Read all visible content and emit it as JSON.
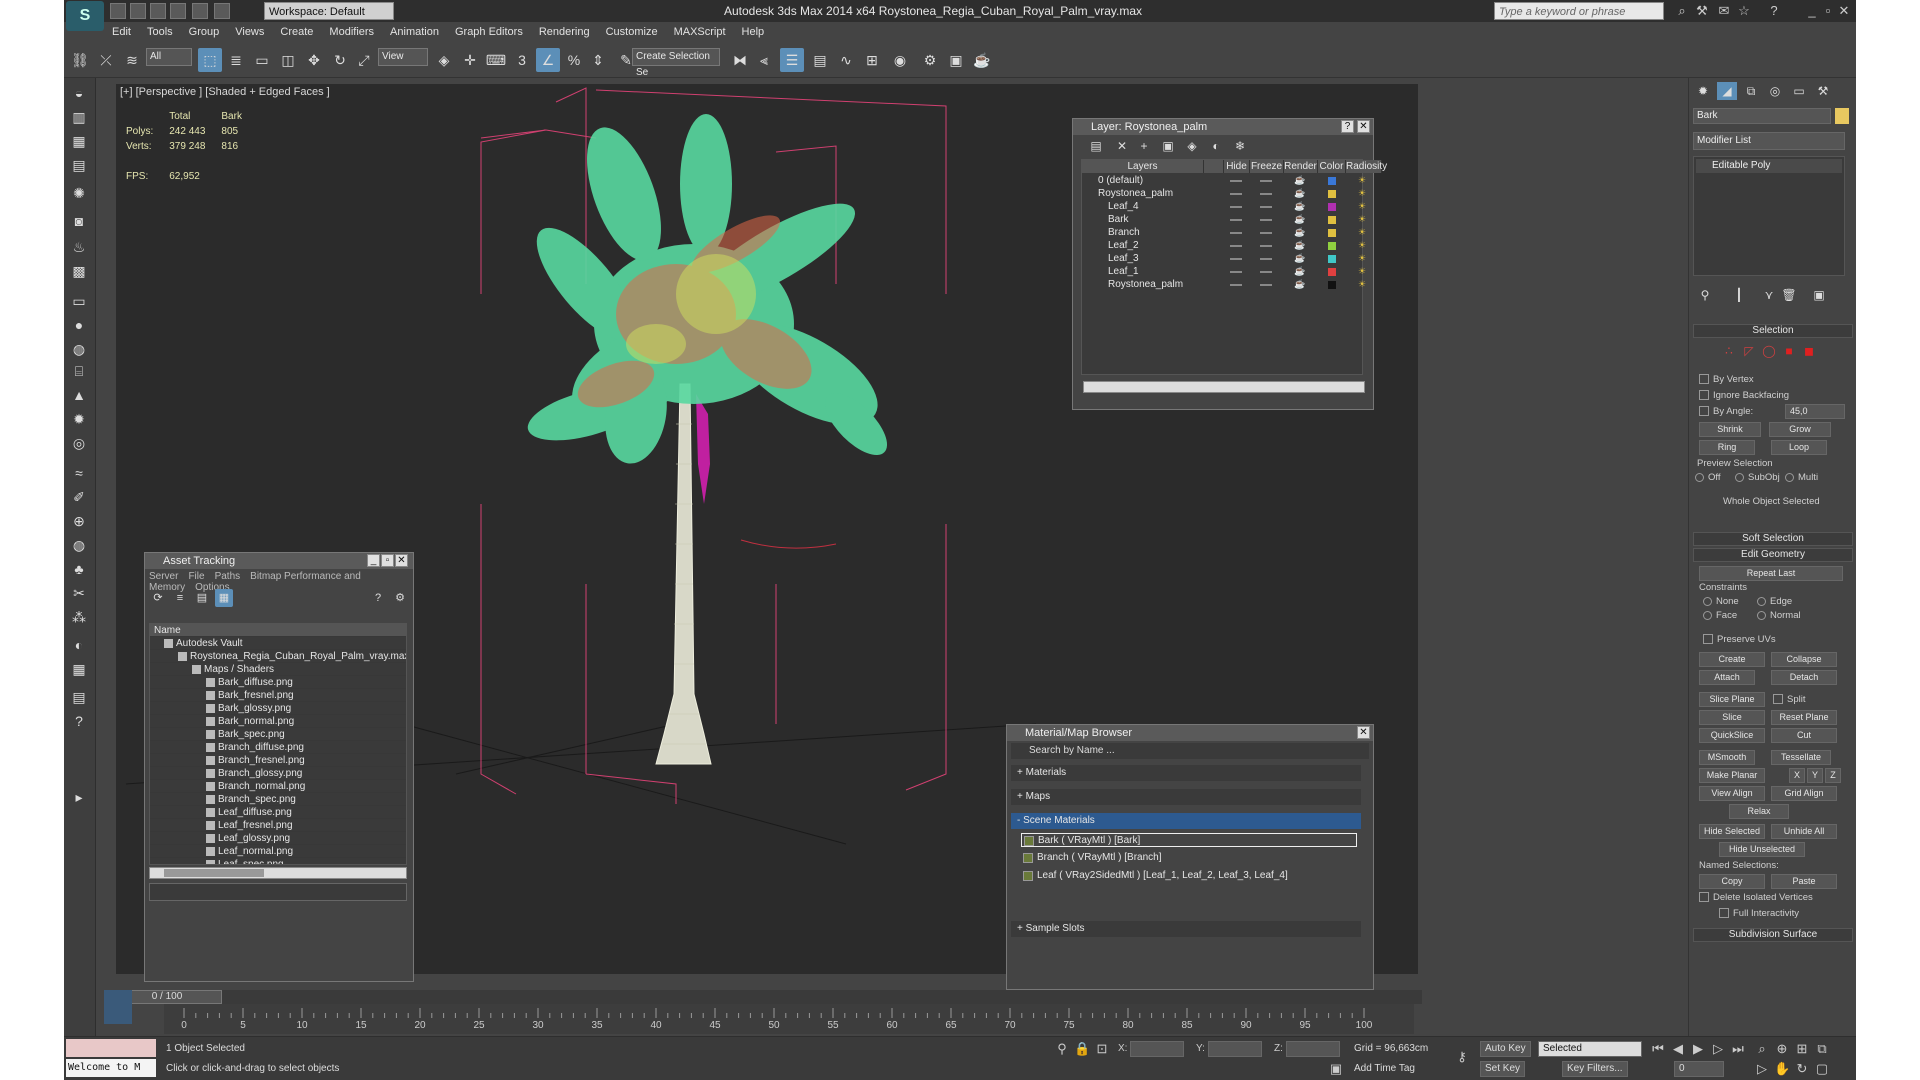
{
  "app": {
    "title": "Autodesk 3ds Max  2014 x64      Roystonea_Regia_Cuban_Royal_Palm_vray.max",
    "workspace": "Workspace: Default",
    "search_placeholder": "Type a keyword or phrase",
    "logo_icon": "3ds-max-logo-icon"
  },
  "menu": [
    "Edit",
    "Tools",
    "Group",
    "Views",
    "Create",
    "Modifiers",
    "Animation",
    "Graph Editors",
    "Rendering",
    "Customize",
    "MAXScript",
    "Help"
  ],
  "toolbar": {
    "filter_all": "All",
    "view_dropdown": "View",
    "snap_label": "3",
    "selection_set": "Create Selection Se"
  },
  "viewport": {
    "label": "[+] [Perspective ] [Shaded + Edged Faces ]",
    "stats": {
      "col_total": "Total",
      "col_selected": "Bark",
      "polys_label": "Polys:",
      "polys_total": "242 443",
      "polys_selected": "805",
      "verts_label": "Verts:",
      "verts_total": "379 248",
      "verts_selected": "816",
      "fps_label": "FPS:",
      "fps_value": "62,952"
    }
  },
  "asset_tracking": {
    "title": "Asset Tracking",
    "menu": [
      "Server",
      "File",
      "Paths",
      "Bitmap Performance and Memory",
      "Options"
    ],
    "column": "Name",
    "rows": [
      {
        "label": "Autodesk Vault",
        "indent": 1
      },
      {
        "label": "Roystonea_Regia_Cuban_Royal_Palm_vray.max",
        "indent": 2
      },
      {
        "label": "Maps / Shaders",
        "indent": 3
      },
      {
        "label": "Bark_diffuse.png",
        "indent": 4
      },
      {
        "label": "Bark_fresnel.png",
        "indent": 4
      },
      {
        "label": "Bark_glossy.png",
        "indent": 4
      },
      {
        "label": "Bark_normal.png",
        "indent": 4
      },
      {
        "label": "Bark_spec.png",
        "indent": 4
      },
      {
        "label": "Branch_diffuse.png",
        "indent": 4
      },
      {
        "label": "Branch_fresnel.png",
        "indent": 4
      },
      {
        "label": "Branch_glossy.png",
        "indent": 4
      },
      {
        "label": "Branch_normal.png",
        "indent": 4
      },
      {
        "label": "Branch_spec.png",
        "indent": 4
      },
      {
        "label": "Leaf_diffuse.png",
        "indent": 4
      },
      {
        "label": "Leaf_fresnel.png",
        "indent": 4
      },
      {
        "label": "Leaf_glossy.png",
        "indent": 4
      },
      {
        "label": "Leaf_normal.png",
        "indent": 4
      },
      {
        "label": "Leaf_spec.png",
        "indent": 4
      }
    ]
  },
  "layer_window": {
    "title": "Layer: Roystonea_palm",
    "columns": [
      "Layers",
      "Hide",
      "Freeze",
      "Render",
      "Color",
      "Radiosity"
    ],
    "rows": [
      {
        "name": "0 (default)",
        "indent": 1,
        "color": "#3a78d8"
      },
      {
        "name": "Roystonea_palm",
        "indent": 1,
        "color": "#e0c040"
      },
      {
        "name": "Leaf_4",
        "indent": 2,
        "color": "#b030b0"
      },
      {
        "name": "Bark",
        "indent": 2,
        "color": "#e0c040"
      },
      {
        "name": "Branch",
        "indent": 2,
        "color": "#e0c040"
      },
      {
        "name": "Leaf_2",
        "indent": 2,
        "color": "#90d040"
      },
      {
        "name": "Leaf_3",
        "indent": 2,
        "color": "#40c8c8"
      },
      {
        "name": "Leaf_1",
        "indent": 2,
        "color": "#e04040"
      },
      {
        "name": "Roystonea_palm",
        "indent": 2,
        "color": "#111111"
      }
    ]
  },
  "material_browser": {
    "title": "Material/Map Browser",
    "search": "Search by Name ...",
    "sections": [
      "+ Materials",
      "+ Maps",
      "- Scene Materials",
      "+ Sample Slots"
    ],
    "scene_materials": [
      "Bark  ( VRayMtl ) [Bark]",
      "Branch  ( VRayMtl ) [Branch]",
      "Leaf  ( VRay2SidedMtl ) [Leaf_1, Leaf_2, Leaf_3, Leaf_4]"
    ]
  },
  "command_panel": {
    "object_name": "Bark",
    "modifier_list": "Modifier List",
    "stack_item": "Editable Poly",
    "selection_title": "Selection",
    "by_vertex": "By Vertex",
    "ignore_backfacing": "Ignore Backfacing",
    "by_angle": "By Angle:",
    "angle_value": "45,0",
    "shrink": "Shrink",
    "grow": "Grow",
    "ring": "Ring",
    "loop": "Loop",
    "preview_selection": "Preview Selection",
    "preview_off": "Off",
    "preview_subobj": "SubObj",
    "preview_multi": "Multi",
    "whole_object": "Whole Object Selected",
    "soft_selection": "Soft Selection",
    "edit_geometry": "Edit Geometry",
    "repeat_last": "Repeat Last",
    "constraints": "Constraints",
    "c_none": "None",
    "c_edge": "Edge",
    "c_face": "Face",
    "c_normal": "Normal",
    "preserve_uvs": "Preserve UVs",
    "create": "Create",
    "collapse": "Collapse",
    "attach": "Attach",
    "detach": "Detach",
    "slice_plane": "Slice Plane",
    "split": "Split",
    "slice": "Slice",
    "reset_plane": "Reset Plane",
    "quickslice": "QuickSlice",
    "cut": "Cut",
    "msmooth": "MSmooth",
    "tessellate": "Tessellate",
    "make_planar": "Make Planar",
    "x": "X",
    "y": "Y",
    "z": "Z",
    "view_align": "View Align",
    "grid_align": "Grid Align",
    "relax": "Relax",
    "hide_selected": "Hide Selected",
    "unhide_all": "Unhide All",
    "hide_unselected": "Hide Unselected",
    "named_selections": "Named Selections:",
    "copy": "Copy",
    "paste": "Paste",
    "delete_isolated": "Delete Isolated Vertices",
    "full_interactivity": "Full Interactivity",
    "subdivision_surface": "Subdivision Surface"
  },
  "timeline": {
    "frame": "0 / 100",
    "ticks": [
      "0",
      "5",
      "10",
      "15",
      "20",
      "25",
      "30",
      "35",
      "40",
      "45",
      "50",
      "55",
      "60",
      "65",
      "70",
      "75",
      "80",
      "85",
      "90",
      "95",
      "100"
    ]
  },
  "status": {
    "maxscript": "Welcome to M",
    "selected": "1 Object Selected",
    "prompt": "Click or click-and-drag to select objects",
    "x_label": "X:",
    "y_label": "Y:",
    "z_label": "Z:",
    "grid": "Grid = 96,663cm",
    "add_time_tag": "Add Time Tag",
    "auto_key": "Auto Key",
    "set_key": "Set Key",
    "selected_dropdown": "Selected",
    "key_filters": "Key Filters...",
    "frame_value": "0"
  }
}
